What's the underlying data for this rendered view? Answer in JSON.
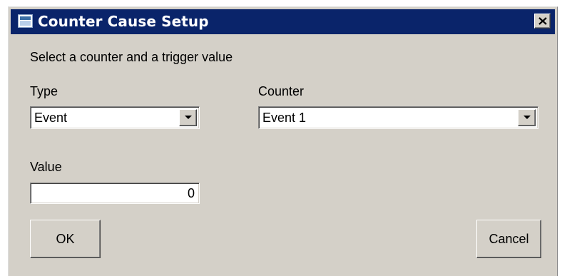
{
  "window": {
    "title": "Counter Cause Setup",
    "icon": "window-icon",
    "close_glyph": "close-icon"
  },
  "dialog": {
    "instruction": "Select a counter and a trigger value",
    "type_label": "Type",
    "type_value": "Event",
    "counter_label": "Counter",
    "counter_value": "Event 1",
    "value_label": "Value",
    "value_value": "0",
    "ok_label": "OK",
    "cancel_label": "Cancel"
  },
  "colors": {
    "titlebar": "#0a246a",
    "face": "#d4d0c8"
  }
}
